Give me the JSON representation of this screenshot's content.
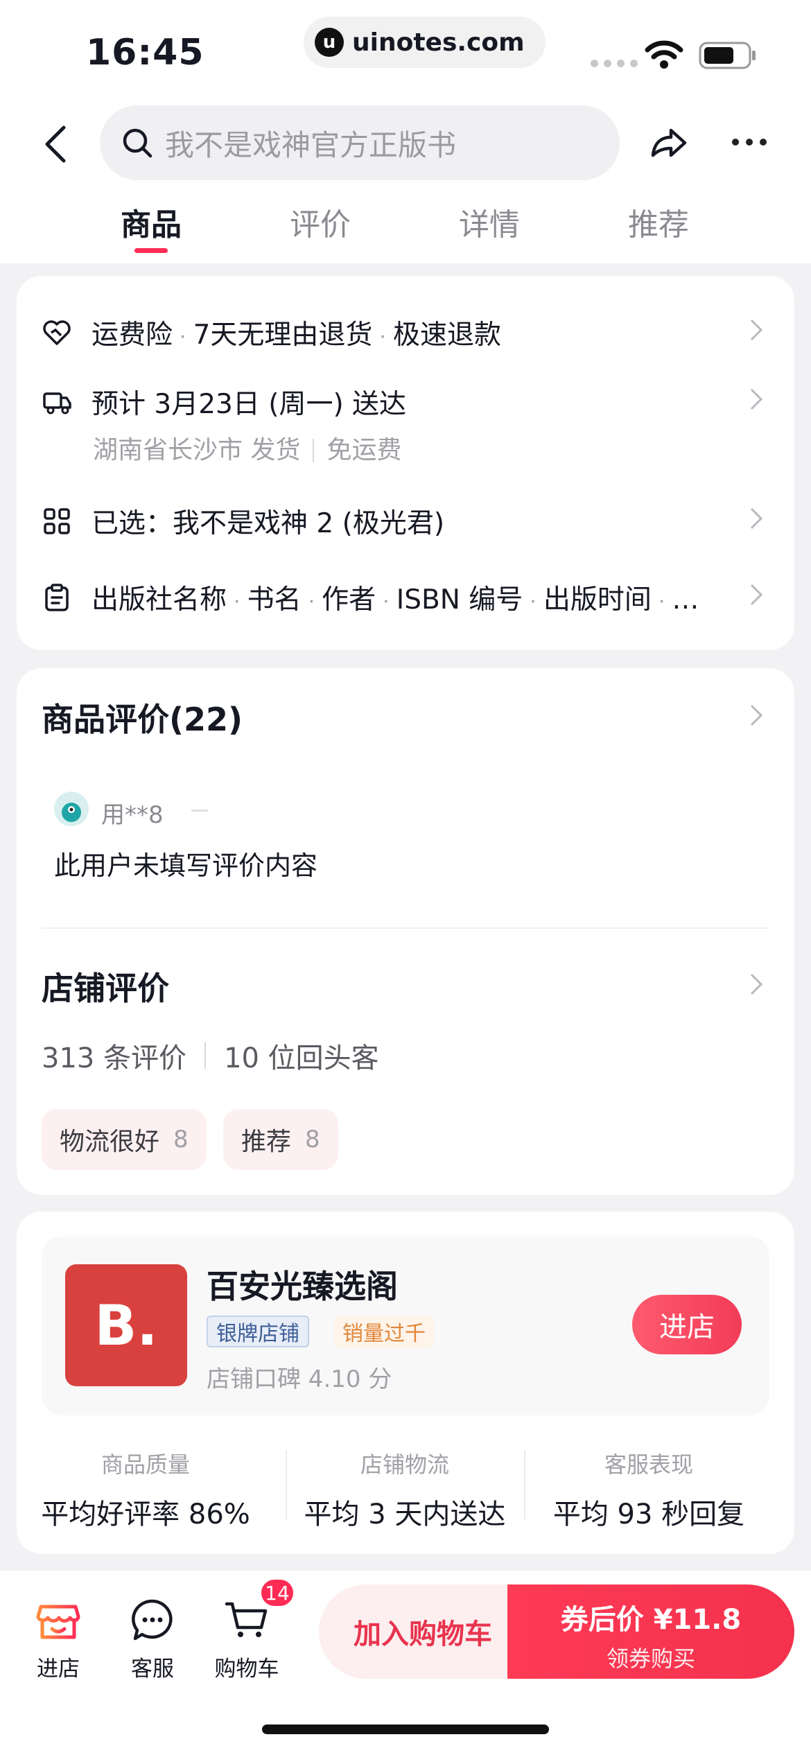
{
  "status_bar": {
    "time": "16:45",
    "url": "uinotes.com"
  },
  "header": {
    "search_placeholder": "我不是戏神官方正版书",
    "tabs": [
      {
        "label": "商品",
        "active": true
      },
      {
        "label": "评价",
        "active": false
      },
      {
        "label": "详情",
        "active": false
      },
      {
        "label": "推荐",
        "active": false
      }
    ]
  },
  "services": {
    "guarantees": [
      "运费险",
      "7天无理由退货",
      "极速退款"
    ],
    "delivery_estimate": "预计 3月23日 (周一) 送达",
    "ship_from": "湖南省长沙市 发货",
    "shipping_fee": "免运费",
    "selected": "已选：我不是戏神 2 (极光君)",
    "params": [
      "出版社名称",
      "书名",
      "作者",
      "ISBN 编号",
      "出版时间",
      "…"
    ]
  },
  "reviews": {
    "title": "商品评价(22)",
    "user": "用**8",
    "content": "此用户未填写评价内容",
    "shop_title": "店铺评价",
    "review_count": "313 条评价",
    "repeat_customers": "10 位回头客",
    "tags": [
      {
        "label": "物流很好",
        "count": "8"
      },
      {
        "label": "推荐",
        "count": "8"
      }
    ]
  },
  "store": {
    "logo_text": "B.",
    "name": "百安光臻选阁",
    "badge_tier": "银牌店铺",
    "badge_sales": "销量过千",
    "rating": "店铺口碑 4.10 分",
    "enter_label": "进店",
    "metrics": [
      {
        "label": "商品质量",
        "value": "平均好评率 86%"
      },
      {
        "label": "店铺物流",
        "value": "平均 3 天内送达"
      },
      {
        "label": "客服表现",
        "value": "平均 93 秒回复"
      }
    ]
  },
  "bottom_bar": {
    "shop_label": "进店",
    "service_label": "客服",
    "cart_label": "购物车",
    "cart_count": "14",
    "add_to_cart": "加入购物车",
    "price_label": "券后价 ¥11.8",
    "buy_label": "领券购买"
  },
  "colors": {
    "accent": "#fe2c55",
    "store_logo": "#d9413e"
  }
}
